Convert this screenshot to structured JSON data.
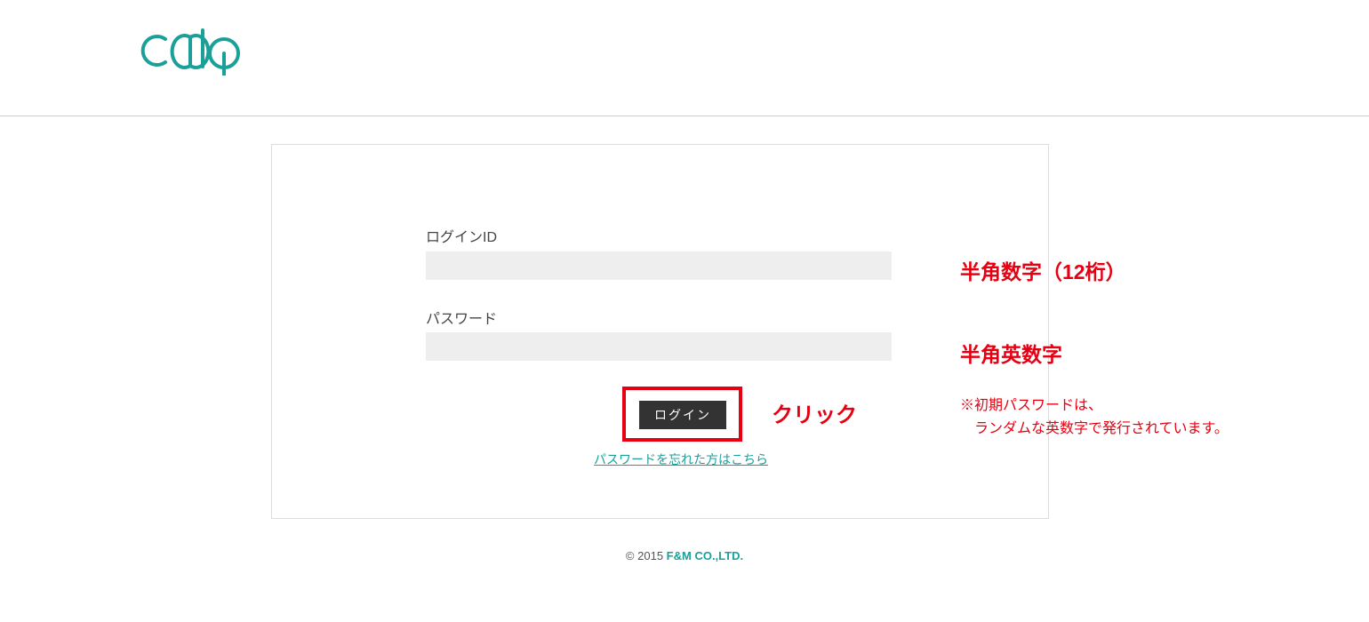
{
  "brand": {
    "logo_text": "CalQ"
  },
  "form": {
    "login_id_label": "ログインID",
    "login_id_value": "",
    "password_label": "パスワード",
    "password_value": "",
    "login_button": "ログイン",
    "forgot_link": "パスワードを忘れた方はこちら"
  },
  "footer": {
    "copyright_symbol": "©",
    "year": "2015",
    "company": "F&M CO.,LTD."
  },
  "annotations": {
    "click": "クリック",
    "id_hint": "半角数字（12桁）",
    "pw_hint": "半角英数字",
    "pw_note_line1": "※初期パスワードは、",
    "pw_note_line2": "ランダムな英数字で発行されています。"
  }
}
